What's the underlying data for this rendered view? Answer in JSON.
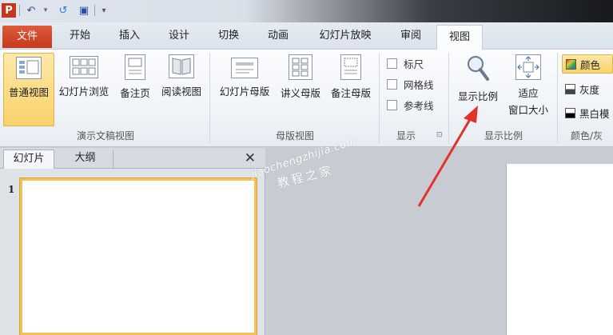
{
  "quick_access": {
    "logo": "P",
    "undo_glyph": "↶",
    "redo_glyph": "↺",
    "save_glyph": "▣",
    "more_glyph": "▾"
  },
  "tabs": [
    {
      "label": "文件"
    },
    {
      "label": "开始"
    },
    {
      "label": "插入"
    },
    {
      "label": "设计"
    },
    {
      "label": "切换"
    },
    {
      "label": "动画"
    },
    {
      "label": "幻灯片放映"
    },
    {
      "label": "审阅"
    },
    {
      "label": "视图"
    }
  ],
  "ribbon": {
    "presentation_views": {
      "label": "演示文稿视图",
      "buttons": [
        "普通视图",
        "幻灯片浏览",
        "备注页",
        "阅读视图"
      ]
    },
    "master_views": {
      "label": "母版视图",
      "buttons": [
        "幻灯片母版",
        "讲义母版",
        "备注母版"
      ]
    },
    "show": {
      "label": "显示",
      "checkboxes": [
        "标尺",
        "网格线",
        "参考线"
      ],
      "launcher": "⊡"
    },
    "zoom": {
      "label": "显示比例",
      "zoom_button": "显示比例",
      "fit_line1": "适应",
      "fit_line2": "窗口大小"
    },
    "color": {
      "label": "颜色/灰",
      "buttons": [
        "颜色",
        "灰度",
        "黑白模"
      ]
    }
  },
  "panel": {
    "tabs": [
      "幻灯片",
      "大纲"
    ],
    "close_glyph": "✕",
    "slide_number": "1"
  },
  "watermark": {
    "line1": "jiaochengzhijia.com",
    "line2": "教程之家"
  },
  "colors": {
    "file_tab": "#c4391c",
    "selected_button": "#f8d16a",
    "arrow": "#e0332a"
  }
}
